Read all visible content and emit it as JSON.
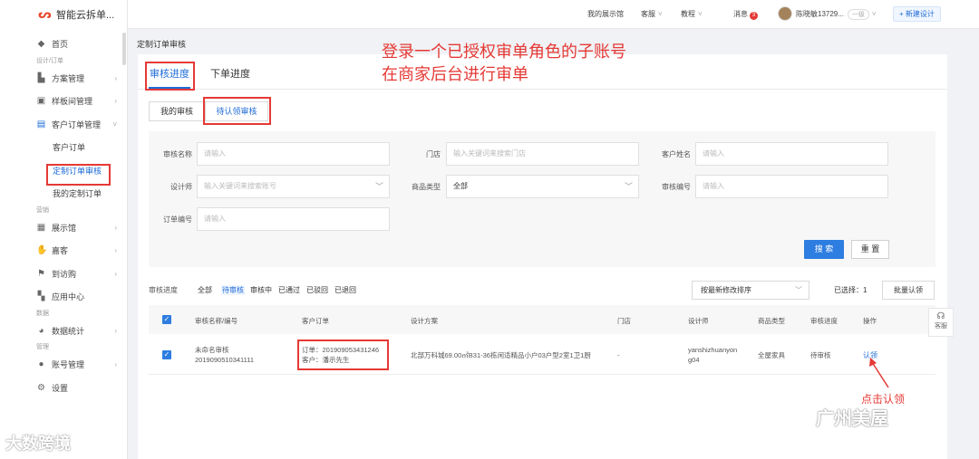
{
  "app": {
    "title": "智能云拆单..."
  },
  "sidebar": {
    "groups": [
      {
        "label": "设计/订单"
      },
      {
        "label": "营销"
      },
      {
        "label": "数据"
      },
      {
        "label": "管理"
      }
    ],
    "items": {
      "home": "首页",
      "plan": "方案管理",
      "sample": "样板间管理",
      "customer_order": "客户订单管理",
      "customer_order_sub": "客户订单",
      "custom_review": "定制订单审核",
      "my_custom": "我的定制订单",
      "showroom": "展示馆",
      "guest": "嘉客",
      "visit": "到访购",
      "app_center": "应用中心",
      "stats": "数据统计",
      "account": "账号管理",
      "settings": "设置"
    }
  },
  "topbar": {
    "my_showroom": "我的展示馆",
    "service": "客服",
    "tutorial": "教程",
    "message": "消息",
    "message_count": "3",
    "user": "陈晓敏13729...",
    "level": "一级",
    "new_design": "+ 新建设计"
  },
  "page": {
    "title": "定制订单审核"
  },
  "tabs": {
    "review_progress": "审核进度",
    "order_progress": "下单进度"
  },
  "subtabs": {
    "my_review": "我的审核",
    "to_claim": "待认领审核"
  },
  "filters": {
    "review_name_label": "审核名称",
    "review_name_placeholder": "请输入",
    "store_label": "门店",
    "store_placeholder": "输入关键词来搜索门店",
    "customer_label": "客户姓名",
    "customer_placeholder": "请输入",
    "designer_label": "设计师",
    "designer_placeholder": "输入关键词来搜索账号",
    "product_type_label": "商品类型",
    "product_type_value": "全部",
    "review_no_label": "审核编号",
    "review_no_placeholder": "请输入",
    "order_no_label": "订单编号",
    "order_no_placeholder": "请输入",
    "search": "搜 索",
    "reset": "重 置"
  },
  "status_bar": {
    "label": "审核进度",
    "options": [
      "全部",
      "待审核",
      "审核中",
      "已通过",
      "已驳回",
      "已退回"
    ],
    "sort": "按最新修改排序",
    "selected": "已选择：1",
    "batch_claim": "批量认领"
  },
  "table": {
    "headers": [
      "审核名称/编号",
      "客户订单",
      "设计方案",
      "门店",
      "设计师",
      "商品类型",
      "审核进度",
      "操作"
    ],
    "rows": [
      {
        "name": "未命名审核",
        "code": "2019090510341111",
        "order": "订单：201909053431246",
        "customer": "客户：潘示先生",
        "design": "北部万科城69.00㎡B31-36栋闲适精品小户03户型2室1卫1厨",
        "store": "-",
        "designer1": "yanshizhuanyon",
        "designer2": "g04",
        "product_type": "全屋家具",
        "status": "待审核",
        "action": "认领"
      }
    ]
  },
  "float": {
    "service": "客服"
  },
  "annotations": {
    "line1": "登录一个已授权审单角色的子账号",
    "line2": "在商家后台进行审单",
    "click_claim": "点击认领"
  },
  "watermarks": {
    "left": "大数跨境",
    "right": "广州美屋"
  }
}
